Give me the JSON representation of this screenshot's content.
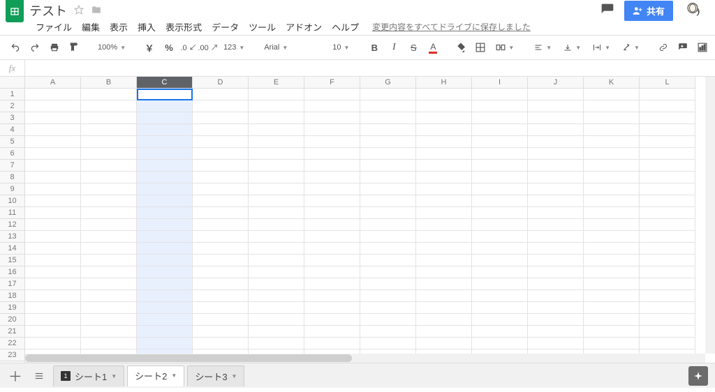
{
  "doc": {
    "title": "テスト"
  },
  "menus": [
    "ファイル",
    "編集",
    "表示",
    "挿入",
    "表示形式",
    "データ",
    "ツール",
    "アドオン",
    "ヘルプ"
  ],
  "save_status": "変更内容をすべてドライブに保存しました",
  "share_label": "共有",
  "toolbar": {
    "zoom": "100%",
    "font": "Arial",
    "font_size": "10",
    "more": "…"
  },
  "formula": {
    "label": "fx",
    "value": ""
  },
  "columns": [
    "A",
    "B",
    "C",
    "D",
    "E",
    "F",
    "G",
    "H",
    "I",
    "J",
    "K",
    "L"
  ],
  "row_count": 24,
  "selected_column_index": 2,
  "sheets": [
    {
      "label": "シート1",
      "active": false,
      "badge": "1"
    },
    {
      "label": "シート2",
      "active": true
    },
    {
      "label": "シート3",
      "active": false
    }
  ]
}
